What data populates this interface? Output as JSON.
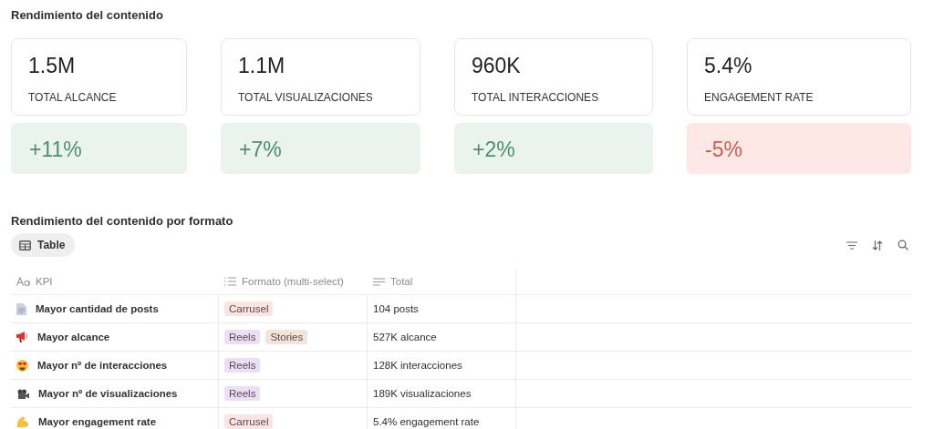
{
  "title": "Rendimiento del contenido",
  "metrics": [
    {
      "value": "1.5M",
      "label": "TOTAL ALCANCE",
      "change": "+11%",
      "kind": "up"
    },
    {
      "value": "1.1M",
      "label": "TOTAL VISUALIZACIONES",
      "change": "+7%",
      "kind": "up"
    },
    {
      "value": "960K",
      "label": "TOTAL INTERACCIONES",
      "change": "+2%",
      "kind": "up"
    },
    {
      "value": "5.4%",
      "label": "ENGAGEMENT RATE",
      "change": "-5%",
      "kind": "down"
    }
  ],
  "table_title": "Rendimiento del contenido por formato",
  "view_tab": {
    "label": "Table",
    "selected": true
  },
  "table": {
    "columns": [
      {
        "label": "KPI",
        "kind": "title"
      },
      {
        "label": "Formato (multi-select)",
        "kind": "multi"
      },
      {
        "label": "Total",
        "kind": "text"
      }
    ],
    "rows": [
      {
        "kpi": "Mayor cantidad de posts",
        "formats": [
          {
            "label": "Carrusel",
            "color": "#fbe4e4"
          }
        ],
        "total": "104 posts"
      },
      {
        "kpi": "Mayor alcance",
        "formats": [
          {
            "label": "Reels",
            "color": "#ebdff5"
          },
          {
            "label": "Stories",
            "color": "#f4e4da"
          }
        ],
        "total": "527K alcance"
      },
      {
        "kpi": "Mayor nº de interacciones",
        "formats": [
          {
            "label": "Reels",
            "color": "#ebdff5"
          }
        ],
        "total": "128K interacciones"
      },
      {
        "kpi": "Mayor nº de visualizaciones",
        "formats": [
          {
            "label": "Reels",
            "color": "#ebdff5"
          }
        ],
        "total": "189K visualizaciones"
      },
      {
        "kpi": "Mayor engagement rate",
        "formats": [
          {
            "label": "Carrusel",
            "color": "#fbe4e4"
          }
        ],
        "total": "5.4% engagement rate"
      }
    ]
  }
}
